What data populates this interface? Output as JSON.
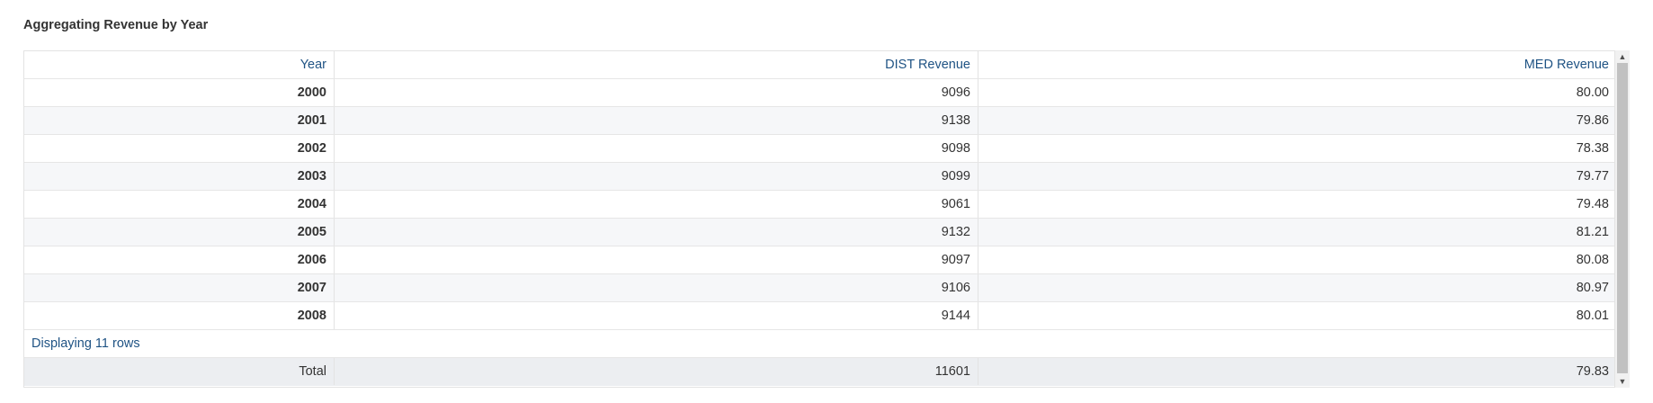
{
  "title": "Aggregating Revenue by Year",
  "table": {
    "headers": [
      "Year",
      "DIST Revenue",
      "MED Revenue"
    ],
    "rows": [
      {
        "year": "2000",
        "dist": "9096",
        "med": "80.00"
      },
      {
        "year": "2001",
        "dist": "9138",
        "med": "79.86"
      },
      {
        "year": "2002",
        "dist": "9098",
        "med": "78.38"
      },
      {
        "year": "2003",
        "dist": "9099",
        "med": "79.77"
      },
      {
        "year": "2004",
        "dist": "9061",
        "med": "79.48"
      },
      {
        "year": "2005",
        "dist": "9132",
        "med": "81.21"
      },
      {
        "year": "2006",
        "dist": "9097",
        "med": "80.08"
      },
      {
        "year": "2007",
        "dist": "9106",
        "med": "80.97"
      },
      {
        "year": "2008",
        "dist": "9144",
        "med": "80.01"
      }
    ],
    "row_count_note": "Displaying 11 rows",
    "total": {
      "label": "Total",
      "dist": "11601",
      "med": "79.83"
    }
  },
  "scrollbar": {
    "up_icon": "▲",
    "down_icon": "▼"
  },
  "colors": {
    "header_text": "#1f5384",
    "alt_row": "#f6f7f9",
    "total_row": "#eceef1"
  }
}
